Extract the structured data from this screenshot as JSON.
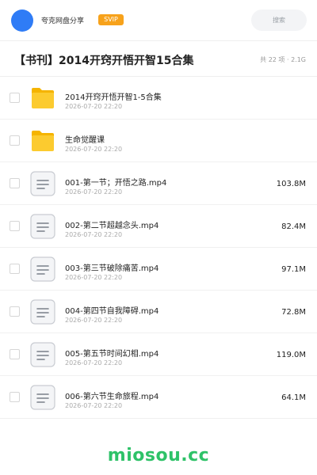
{
  "header": {
    "brand": "夸克网盘分享",
    "badge": "SVIP",
    "search_placeholder": "搜索",
    "accent_color": "#2f7cf6",
    "badge_color": "#f7a21b"
  },
  "folder": {
    "title": "【书刊】2014开窍开悟开智15合集",
    "summary": "共 22 项 · 2.1G"
  },
  "items": [
    {
      "type": "folder",
      "icon": "folder-icon",
      "name": "2014开窍开悟开智1-5合集",
      "date": "2026-07-20 22:20",
      "size": ""
    },
    {
      "type": "folder",
      "icon": "folder-icon",
      "name": "生命觉醒课",
      "date": "2026-07-20 22:20",
      "size": ""
    },
    {
      "type": "file",
      "icon": "video-file-icon",
      "name": "001-第一节；开悟之路.mp4",
      "date": "2026-07-20 22:20",
      "size": "103.8M"
    },
    {
      "type": "file",
      "icon": "video-file-icon",
      "name": "002-第二节超越念头.mp4",
      "date": "2026-07-20 22:20",
      "size": "82.4M"
    },
    {
      "type": "file",
      "icon": "video-file-icon",
      "name": "003-第三节破除痛苦.mp4",
      "date": "2026-07-20 22:20",
      "size": "97.1M"
    },
    {
      "type": "file",
      "icon": "video-file-icon",
      "name": "004-第四节自我障碍.mp4",
      "date": "2026-07-20 22:20",
      "size": "72.8M"
    },
    {
      "type": "file",
      "icon": "video-file-icon",
      "name": "005-第五节时间幻相.mp4",
      "date": "2026-07-20 22:20",
      "size": "119.0M"
    },
    {
      "type": "file",
      "icon": "video-file-icon",
      "name": "006-第六节生命旅程.mp4",
      "date": "2026-07-20 22:20",
      "size": "64.1M"
    }
  ],
  "watermark": {
    "text": "miosou.cc",
    "color": "#2ec268"
  }
}
